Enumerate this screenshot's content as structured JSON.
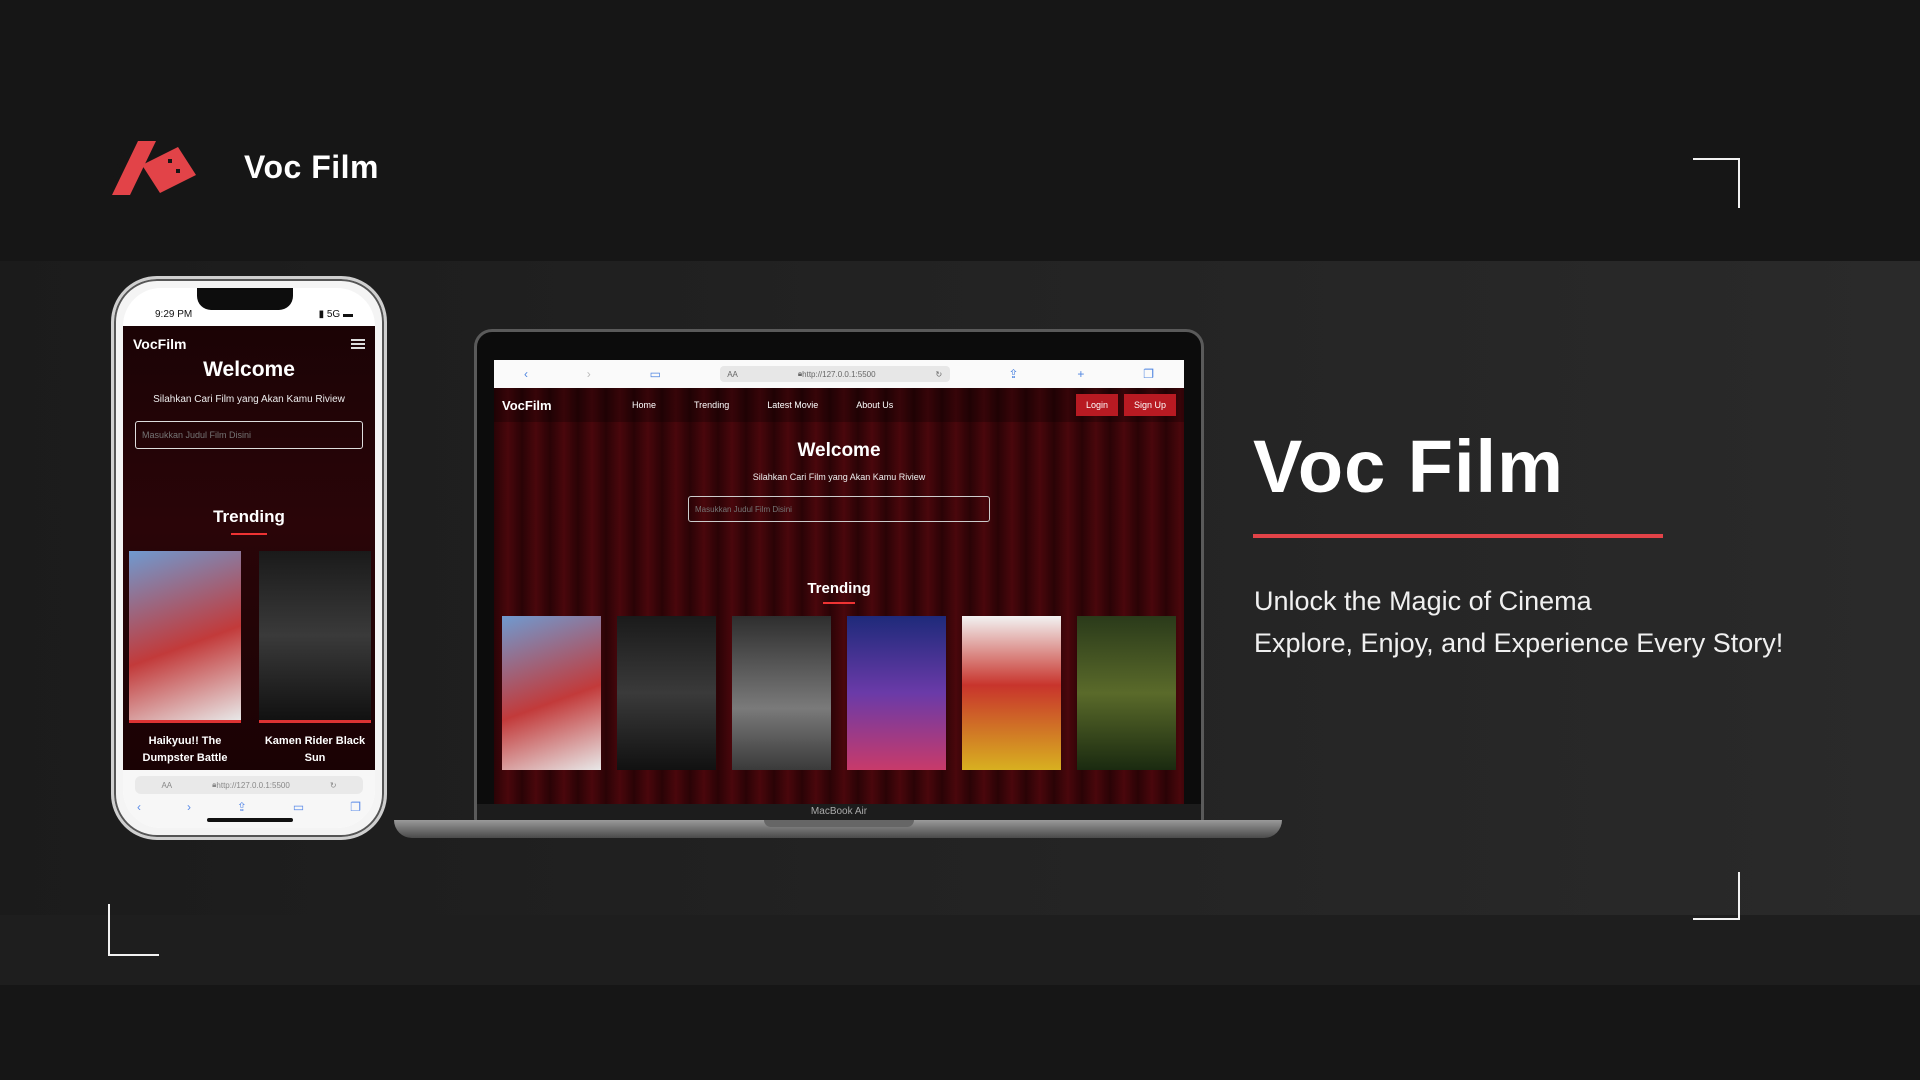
{
  "brand": {
    "name": "Voc Film",
    "accent": "#e24348"
  },
  "hero": {
    "title": "Voc Film",
    "tagline_1": "Unlock the Magic of Cinema",
    "tagline_2": "Explore, Enjoy, and Experience Every Story!"
  },
  "phone": {
    "time": "9:29 PM",
    "signal": "5G",
    "app_logo": "VocFilm",
    "welcome": "Welcome",
    "subtitle": "Silahkan Cari Film yang Akan Kamu Riview",
    "search_placeholder": "Masukkan Judul Film Disini",
    "trending": "Trending",
    "posters": [
      {
        "title": "Haikyuu!! The Dumpster Battle"
      },
      {
        "title": "Kamen Rider Black Sun"
      }
    ],
    "url": "http://127.0.0.1:5500",
    "aa": "AA"
  },
  "laptop": {
    "url": "http://127.0.0.1:5500",
    "aa": "AA",
    "app_logo": "VocFilm",
    "nav": [
      "Home",
      "Trending",
      "Latest Movie",
      "About Us"
    ],
    "login": "Login",
    "signup": "Sign Up",
    "welcome": "Welcome",
    "subtitle": "Silahkan Cari Film yang Akan Kamu Riview",
    "search_placeholder": "Masukkan Judul Film Disini",
    "trending": "Trending",
    "device_label": "MacBook Air"
  },
  "poster_colors": [
    "#5a7fb8",
    "#2a2a2a",
    "#6a6a6a",
    "#3b2a8a",
    "#c8342c",
    "#3a5a2a"
  ]
}
